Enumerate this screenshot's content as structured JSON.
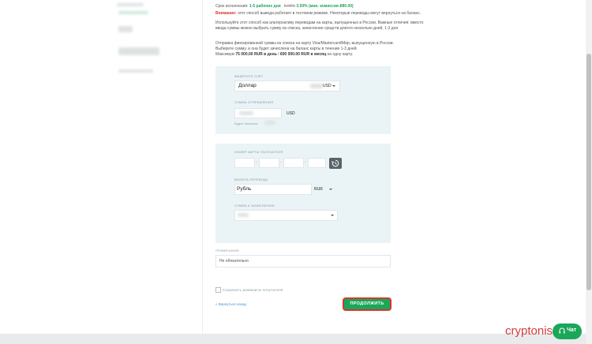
{
  "info": {
    "term_label": "Срок исполнения:",
    "term_value": "1-5 рабочих дня",
    "fee_old": "5.00%",
    "fee_value": "3.50% (мин. комиссия ₽80.00)",
    "warning_label": "Внимание:",
    "warning_text": "этот способ вывода работает в тестовом режиме. Некоторые переводы могут вернуться на баланс.",
    "note_line1": "Используйте этот способ как альтернативу переводам на карты, выпущенных в России. Важные отличия: вместо",
    "note_line2": "ввода суммы можно выбрать сумму из списка, зачисление средств длится несколько дней, 1-3 дня",
    "desc_line1": "Отправка фиксированной суммы из списка на карту Visa/Mastercard/Мир, выпущенную в России.",
    "desc_line2": "Выберите сумму, и она будет зачислена на баланс карты в течение 1-3 дней.",
    "limit_prefix": "Максимум",
    "limit_day": "75 000.00 RUR в день",
    "limit_mid": "/",
    "limit_month": "600 000.00 RUR в месяц",
    "limit_suffix": "на одну карту."
  },
  "form": {
    "source_account_label": "Выберите счёт",
    "source_account_value": "Доллар",
    "source_account_currency": "USD",
    "send_amount_label": "Сумма отправления",
    "send_amount_currency": "USD",
    "available_label": "Будет списано:",
    "card_number_label": "Номер карты получателя",
    "dest_currency_label": "Валюта перевода",
    "dest_currency_value": "Рубль",
    "dest_currency_code": "RUR",
    "amount_select_label": "Сумма к зачислению",
    "comment_label": "Примечание",
    "comment_placeholder": "Не обязательно",
    "save_template_label": "Сохранить реквизиты получателя",
    "back_link": "« Вернуться назад",
    "submit_label": "ПРОДОЛЖИТЬ"
  },
  "chat": {
    "label": "Чат"
  },
  "watermark": "cryptonisa",
  "colors": {
    "accent": "#1aa75a",
    "warning": "#d9352c",
    "panel": "#eaf3f6"
  }
}
